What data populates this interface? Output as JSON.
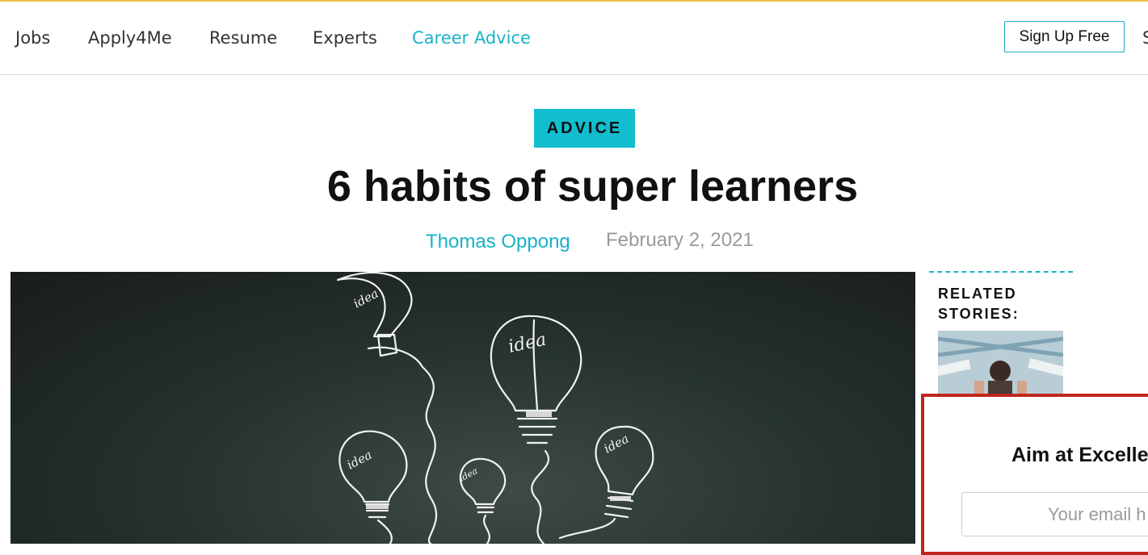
{
  "nav": {
    "items": [
      {
        "label": "Jobs",
        "active": false
      },
      {
        "label": "Apply4Me",
        "active": false
      },
      {
        "label": "Resume",
        "active": false
      },
      {
        "label": "Experts",
        "active": false
      },
      {
        "label": "Career Advice",
        "active": true
      }
    ],
    "signup_label": "Sign Up Free",
    "overflow_label": "S"
  },
  "article": {
    "category": "ADVICE",
    "title": "6 habits of super learners",
    "author": "Thomas Oppong",
    "date": "February 2, 2021",
    "hero_bulb_label": "idea"
  },
  "sidebar": {
    "related_heading": "RELATED STORIES:"
  },
  "popup": {
    "title": "Aim at Excelle",
    "email_placeholder": "Your email h"
  },
  "colors": {
    "accent": "#17b3c7",
    "badge": "#12bdd0",
    "top_border": "#f0c24d",
    "popup_border": "#c0261f"
  }
}
